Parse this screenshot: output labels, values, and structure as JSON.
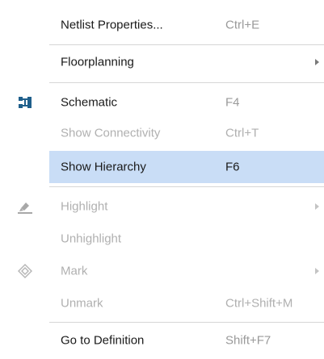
{
  "menu": {
    "items": [
      {
        "label": "Netlist Properties...",
        "shortcut": "Ctrl+E",
        "enabled": true,
        "submenu": false
      },
      {
        "label": "Floorplanning",
        "shortcut": "",
        "enabled": true,
        "submenu": true
      },
      {
        "label": "Schematic",
        "shortcut": "F4",
        "enabled": true,
        "submenu": false,
        "icon": "schematic-icon"
      },
      {
        "label": "Show Connectivity",
        "shortcut": "Ctrl+T",
        "enabled": false,
        "submenu": false
      },
      {
        "label": "Show Hierarchy",
        "shortcut": "F6",
        "enabled": true,
        "submenu": false,
        "highlighted": true
      },
      {
        "label": "Highlight",
        "shortcut": "",
        "enabled": false,
        "submenu": true,
        "icon": "highlight-icon"
      },
      {
        "label": "Unhighlight",
        "shortcut": "",
        "enabled": false,
        "submenu": false
      },
      {
        "label": "Mark",
        "shortcut": "",
        "enabled": false,
        "submenu": true,
        "icon": "mark-icon"
      },
      {
        "label": "Unmark",
        "shortcut": "Ctrl+Shift+M",
        "enabled": false,
        "submenu": false
      },
      {
        "label": "Go to Definition",
        "shortcut": "Shift+F7",
        "enabled": true,
        "submenu": false
      }
    ]
  },
  "colors": {
    "highlight_bg": "#c9ddf6",
    "enabled_text": "#1a1a1a",
    "disabled_text": "#b0b0b0",
    "shortcut_text": "#9a9a9a",
    "schematic_icon": "#1f5f8b"
  }
}
